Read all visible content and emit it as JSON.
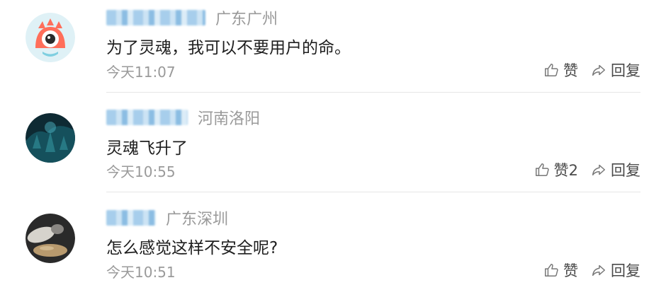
{
  "comments": [
    {
      "location": "广东广州",
      "text": "为了灵魂，我可以不要用户的命。",
      "time": "今天11:07",
      "like_label": "赞",
      "reply_label": "回复"
    },
    {
      "location": "河南洛阳",
      "text": "灵魂飞升了",
      "time": "今天10:55",
      "like_label": "赞2",
      "reply_label": "回复"
    },
    {
      "location": "广东深圳",
      "text": "怎么感觉这样不安全呢?",
      "time": "今天10:51",
      "like_label": "赞",
      "reply_label": "回复"
    }
  ],
  "colors": {
    "username_blur": "#9ec9ea",
    "muted_text": "#9a9a9a",
    "divider": "#e6e6e6"
  },
  "icons": {
    "like": "thumbs-up-icon",
    "reply": "share-arrow-icon"
  }
}
